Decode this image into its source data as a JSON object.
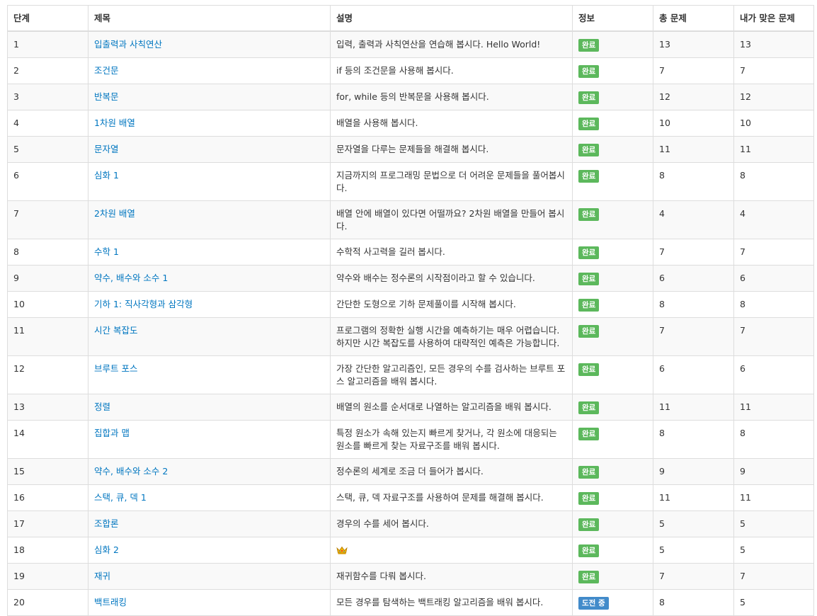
{
  "columns": {
    "step": "단계",
    "title": "제목",
    "description": "설명",
    "info": "정보",
    "total": "총 문제",
    "solved": "내가 맞은 문제"
  },
  "status_colors": {
    "완료": "#5cb85c",
    "도전 중": "#428bca"
  },
  "rows": [
    {
      "step": "1",
      "title": "입출력과 사칙연산",
      "description": "입력, 출력과 사칙연산을 연습해 봅시다. Hello World!",
      "status": "완료",
      "total": "13",
      "solved": "13"
    },
    {
      "step": "2",
      "title": "조건문",
      "description": "if 등의 조건문을 사용해 봅시다.",
      "status": "완료",
      "total": "7",
      "solved": "7"
    },
    {
      "step": "3",
      "title": "반복문",
      "description": "for, while 등의 반복문을 사용해 봅시다.",
      "status": "완료",
      "total": "12",
      "solved": "12"
    },
    {
      "step": "4",
      "title": "1차원 배열",
      "description": "배열을 사용해 봅시다.",
      "status": "완료",
      "total": "10",
      "solved": "10"
    },
    {
      "step": "5",
      "title": "문자열",
      "description": "문자열을 다루는 문제들을 해결해 봅시다.",
      "status": "완료",
      "total": "11",
      "solved": "11"
    },
    {
      "step": "6",
      "title": "심화 1",
      "description": "지금까지의 프로그래밍 문법으로 더 어려운 문제들을 풀어봅시다.",
      "status": "완료",
      "total": "8",
      "solved": "8"
    },
    {
      "step": "7",
      "title": "2차원 배열",
      "description": "배열 안에 배열이 있다면 어떨까요? 2차원 배열을 만들어 봅시다.",
      "status": "완료",
      "total": "4",
      "solved": "4"
    },
    {
      "step": "8",
      "title": "수학 1",
      "description": "수학적 사고력을 길러 봅시다.",
      "status": "완료",
      "total": "7",
      "solved": "7"
    },
    {
      "step": "9",
      "title": "약수, 배수와 소수 1",
      "description": "약수와 배수는 정수론의 시작점이라고 할 수 있습니다.",
      "status": "완료",
      "total": "6",
      "solved": "6"
    },
    {
      "step": "10",
      "title": "기하 1: 직사각형과 삼각형",
      "description": "간단한 도형으로 기하 문제풀이를 시작해 봅시다.",
      "status": "완료",
      "total": "8",
      "solved": "8"
    },
    {
      "step": "11",
      "title": "시간 복잡도",
      "description": "프로그램의 정확한 실행 시간을 예측하기는 매우 어렵습니다. 하지만 시간 복잡도를 사용하여 대략적인 예측은 가능합니다.",
      "status": "완료",
      "total": "7",
      "solved": "7"
    },
    {
      "step": "12",
      "title": "브루트 포스",
      "description": "가장 간단한 알고리즘인, 모든 경우의 수를 검사하는 브루트 포스 알고리즘을 배워 봅시다.",
      "status": "완료",
      "total": "6",
      "solved": "6"
    },
    {
      "step": "13",
      "title": "정렬",
      "description": "배열의 원소를 순서대로 나열하는 알고리즘을 배워 봅시다.",
      "status": "완료",
      "total": "11",
      "solved": "11"
    },
    {
      "step": "14",
      "title": "집합과 맵",
      "description": "특정 원소가 속해 있는지 빠르게 찾거나, 각 원소에 대응되는 원소를 빠르게 찾는 자료구조를 배워 봅시다.",
      "status": "완료",
      "total": "8",
      "solved": "8"
    },
    {
      "step": "15",
      "title": "약수, 배수와 소수 2",
      "description": "정수론의 세계로 조금 더 들어가 봅시다.",
      "status": "완료",
      "total": "9",
      "solved": "9"
    },
    {
      "step": "16",
      "title": "스택, 큐, 덱 1",
      "description": "스택, 큐, 덱 자료구조를 사용하여 문제를 해결해 봅시다.",
      "status": "완료",
      "total": "11",
      "solved": "11"
    },
    {
      "step": "17",
      "title": "조합론",
      "description": "경우의 수를 세어 봅시다.",
      "status": "완료",
      "total": "5",
      "solved": "5"
    },
    {
      "step": "18",
      "title": "심화 2",
      "description": "",
      "description_icon": "crown-icon",
      "status": "완료",
      "total": "5",
      "solved": "5"
    },
    {
      "step": "19",
      "title": "재귀",
      "description": "재귀함수를 다뤄 봅시다.",
      "status": "완료",
      "total": "7",
      "solved": "7"
    },
    {
      "step": "20",
      "title": "백트래킹",
      "description": "모든 경우를 탐색하는 백트래킹 알고리즘을 배워 봅시다.",
      "status": "도전 중",
      "total": "8",
      "solved": "5"
    }
  ]
}
